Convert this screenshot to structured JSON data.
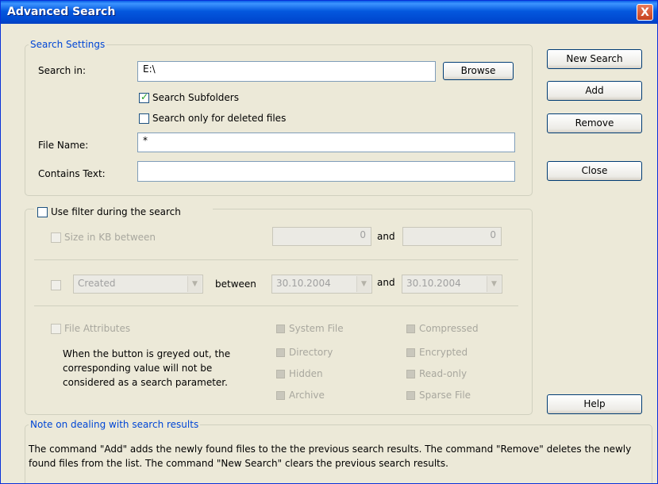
{
  "window": {
    "title": "Advanced Search",
    "close_label": "X"
  },
  "settings": {
    "legend": "Search Settings",
    "search_in_label": "Search in:",
    "search_in_value": "E:\\",
    "browse_label": "Browse",
    "subfolders_label": "Search Subfolders",
    "deleted_label": "Search only for deleted files",
    "filename_label": "File Name:",
    "filename_value": "*",
    "contains_label": "Contains Text:",
    "contains_value": ""
  },
  "buttons": {
    "new_search": "New Search",
    "add": "Add",
    "remove": "Remove",
    "close": "Close",
    "help": "Help"
  },
  "filter": {
    "use_label": "Use filter during the search",
    "size_label": "Size in KB between",
    "size_min": "0",
    "and": "and",
    "size_max": "0",
    "date_type": "Created",
    "between": "between",
    "date_from": "30.10.2004",
    "date_to": "30.10.2004",
    "attributes_label": "File Attributes",
    "attributes_note": "When the button is greyed out, the corresponding value will not be considered as a search parameter.",
    "attrs_col1": [
      "System File",
      "Directory",
      "Hidden",
      "Archive"
    ],
    "attrs_col2": [
      "Compressed",
      "Encrypted",
      "Read-only",
      "Sparse File"
    ]
  },
  "note": {
    "legend": "Note on dealing with search results",
    "text": "The command \"Add\" adds the newly found files to the the previous search results. The command \"Remove\" deletes the newly found files from the list. The command \"New Search\" clears the previous search results."
  },
  "colors": {
    "titlebar": "#0458de",
    "legend": "#0046d5",
    "face": "#ece9d8",
    "check": "#21a121"
  }
}
